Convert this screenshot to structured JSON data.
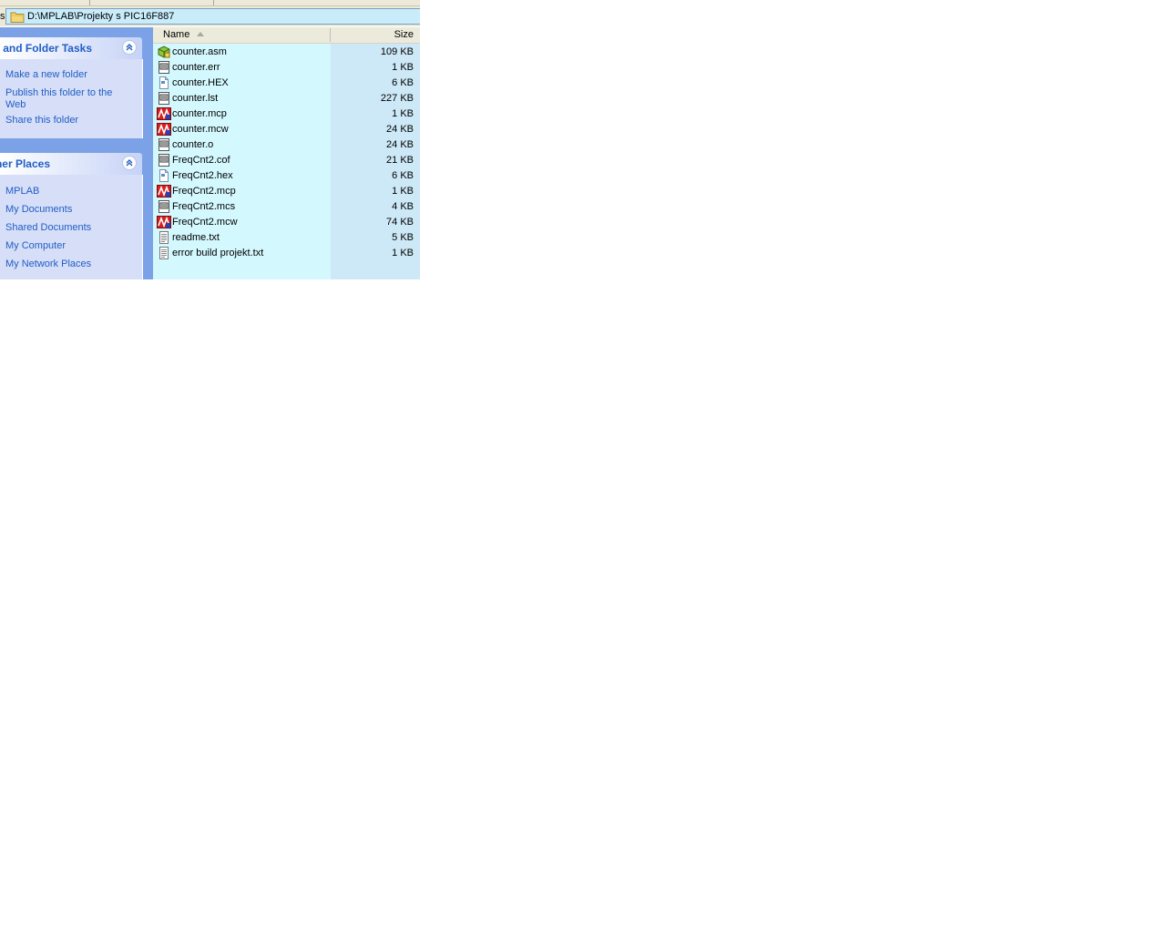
{
  "address": {
    "label_fragment": "s",
    "path": "D:\\MPLAB\\Projekty s PIC16F887"
  },
  "tasks_panel": {
    "title": "e and Folder Tasks",
    "links": [
      "Make a new folder",
      "Publish this folder to the Web",
      "Share this folder"
    ]
  },
  "places_panel": {
    "title": "ner Places",
    "links": [
      "MPLAB",
      "My Documents",
      "Shared Documents",
      "My Computer",
      "My Network Places"
    ]
  },
  "file_list": {
    "columns": {
      "name": "Name",
      "size": "Size"
    },
    "sorted_by": "Name",
    "files": [
      {
        "name": "counter.asm",
        "size": "109 KB",
        "icon": "asm-file-icon"
      },
      {
        "name": "counter.err",
        "size": "1 KB",
        "icon": "generic-file-icon"
      },
      {
        "name": "counter.HEX",
        "size": "6 KB",
        "icon": "hex-file-icon"
      },
      {
        "name": "counter.lst",
        "size": "227 KB",
        "icon": "generic-file-icon"
      },
      {
        "name": "counter.mcp",
        "size": "1 KB",
        "icon": "mplab-file-icon"
      },
      {
        "name": "counter.mcw",
        "size": "24 KB",
        "icon": "mplab-file-icon"
      },
      {
        "name": "counter.o",
        "size": "24 KB",
        "icon": "generic-file-icon"
      },
      {
        "name": "FreqCnt2.cof",
        "size": "21 KB",
        "icon": "generic-file-icon"
      },
      {
        "name": "FreqCnt2.hex",
        "size": "6 KB",
        "icon": "hex-file-icon"
      },
      {
        "name": "FreqCnt2.mcp",
        "size": "1 KB",
        "icon": "mplab-file-icon"
      },
      {
        "name": "FreqCnt2.mcs",
        "size": "4 KB",
        "icon": "generic-file-icon"
      },
      {
        "name": "FreqCnt2.mcw",
        "size": "74 KB",
        "icon": "mplab-file-icon"
      },
      {
        "name": "readme.txt",
        "size": "5 KB",
        "icon": "text-file-icon"
      },
      {
        "name": "error build projekt.txt",
        "size": "1 KB",
        "icon": "text-file-icon"
      }
    ]
  },
  "colors": {
    "link_blue": "#215dc6",
    "pane_blue": "#7ba2e7",
    "list_background": "#d3f8fe"
  }
}
